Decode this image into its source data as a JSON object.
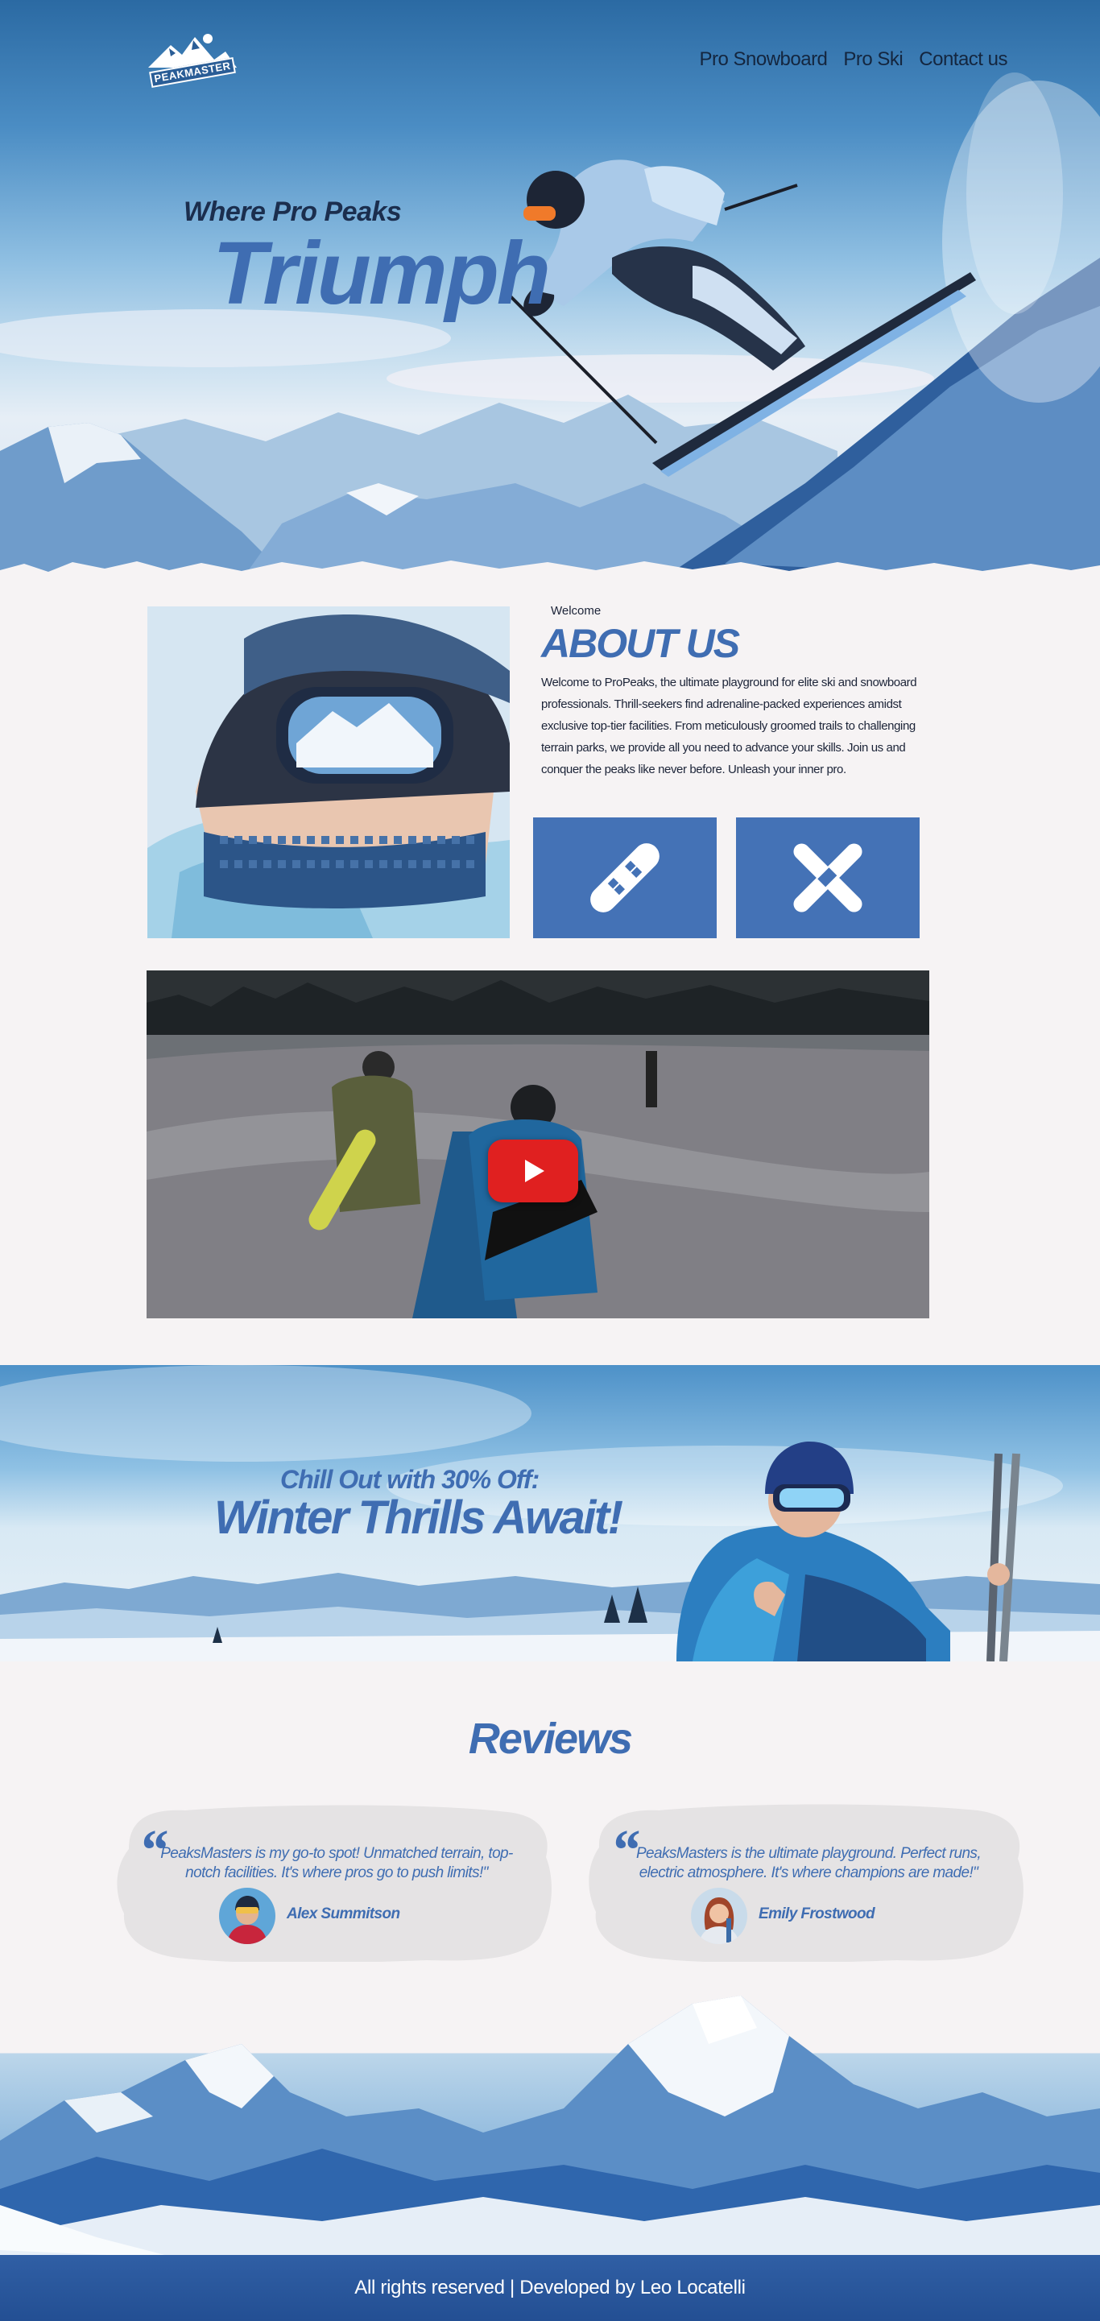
{
  "brand": {
    "logo_text": "PEAKMASTER"
  },
  "nav": {
    "items": [
      "Pro Snowboard",
      "Pro Ski",
      "Contact us"
    ]
  },
  "hero": {
    "subtitle": "Where Pro Peaks",
    "title": "Triumph"
  },
  "about": {
    "label": "Welcome",
    "title": "ABOUT US",
    "text": "Welcome to ProPeaks, the ultimate playground for elite ski and snowboard professionals. Thrill-seekers find adrenaline-packed experiences amidst exclusive top-tier facilities. From meticulously groomed trails to challenging terrain parks, we provide all you need to advance your skills. Join us and conquer the peaks like never before. Unleash your inner pro.",
    "tiles": [
      "snowboard-icon",
      "crossed-skis-icon"
    ]
  },
  "video": {
    "play_icon": "play-icon"
  },
  "promo": {
    "subtitle": "Chill Out with 30% Off:",
    "title": "Winter Thrills Await!"
  },
  "reviews": {
    "title": "Reviews",
    "items": [
      {
        "text": "PeaksMasters is my go-to spot! Unmatched terrain, top-notch facilities. It's where pros go to push limits!\"",
        "name": "Alex Summitson"
      },
      {
        "text": "PeaksMasters  is the ultimate playground. Perfect runs, electric atmosphere. It's where champions are made!\"",
        "name": "Emily Frostwood"
      }
    ]
  },
  "footer": {
    "text": "All rights reserved | Developed by Leo Locatelli"
  },
  "colors": {
    "accent": "#3f6db2",
    "tile": "#4472b6",
    "footer": "#2a5899",
    "play": "#e02020"
  }
}
